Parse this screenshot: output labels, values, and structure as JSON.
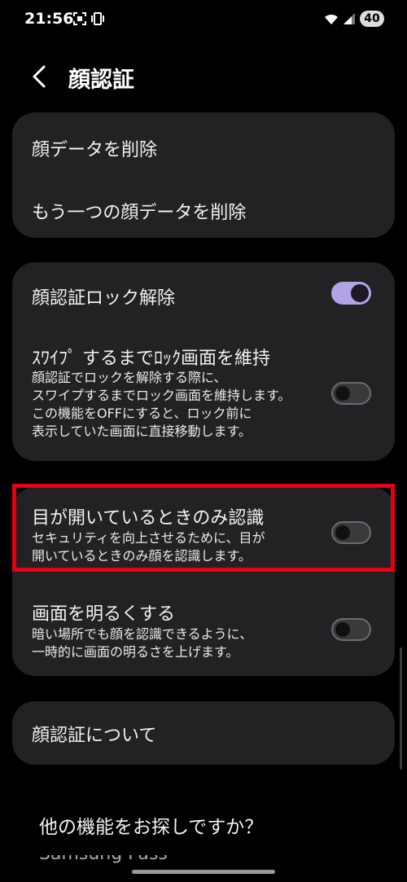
{
  "status_bar": {
    "time": "21:56",
    "battery": "40"
  },
  "header": {
    "title": "顔認証"
  },
  "card1": {
    "delete_face": "顔データを削除",
    "delete_other_face": "もう一つの顔データを削除"
  },
  "card2": {
    "unlock": {
      "title": "顔認証ロック解除",
      "state": "on"
    },
    "swipe": {
      "title": "ｽﾜｲﾌﾟ するまでﾛｯｸ画面を維持",
      "desc": [
        "顔認証でロックを解除する際に、",
        "スワイプするまでロック画面を維持します。",
        "この機能をOFFにすると、ロック前に",
        "表示していた画面に直接移動します。"
      ],
      "state": "off"
    }
  },
  "card3": {
    "eyes_open": {
      "title": "目が開いているときのみ認識",
      "desc": [
        "セキュリティを向上させるために、目が",
        "開いているときのみ顔を認識します。"
      ],
      "state": "off"
    },
    "brighten": {
      "title": "画面を明るくする",
      "desc": [
        "暗い場所でも顔を認識できるように、",
        "一時的に画面の明るさを上げます。"
      ],
      "state": "off"
    }
  },
  "card4": {
    "about": "顔認証について"
  },
  "more": {
    "label": "他の機能をお探しですか？",
    "partial_link": "Samsung Pass"
  },
  "colors": {
    "toggle_on": "#b3a3e6",
    "highlight": "#e60012",
    "card": "#222124"
  }
}
